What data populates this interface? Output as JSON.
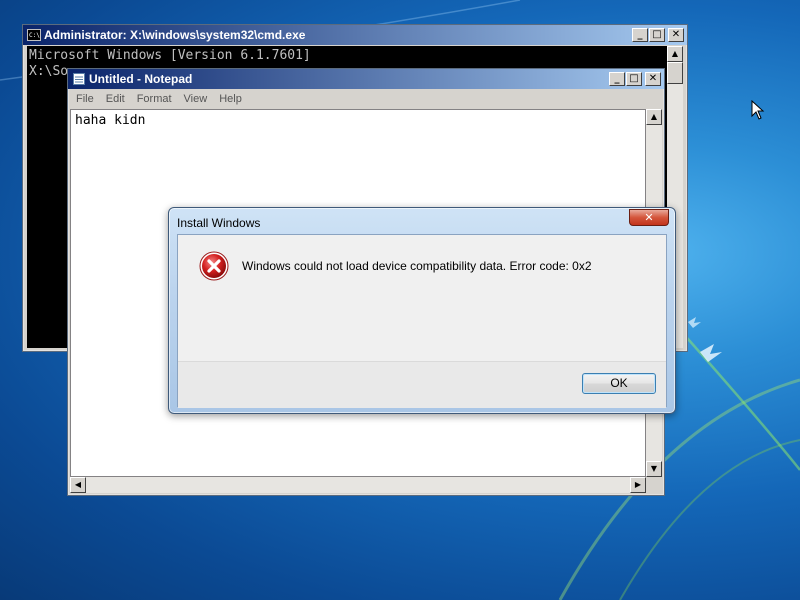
{
  "cmd_window": {
    "title": "Administrator: X:\\windows\\system32\\cmd.exe",
    "console_lines": [
      "Microsoft Windows [Version 6.1.7601]",
      "",
      "X:\\So"
    ]
  },
  "notepad_window": {
    "title": "Untitled - Notepad",
    "menu": [
      "File",
      "Edit",
      "Format",
      "View",
      "Help"
    ],
    "content": "haha kidn"
  },
  "dialog": {
    "title": "Install Windows",
    "message": "Windows could not load device compatibility data. Error code: 0x2",
    "ok_label": "OK",
    "close_glyph": "✕",
    "icon": "error-icon"
  },
  "caption_buttons": {
    "minimize": "_",
    "maximize": "□",
    "close": "✕"
  },
  "colors": {
    "titlebar_active": "#0a246a",
    "console_background": "#000000",
    "dialog_close": "#c2341c",
    "error_red": "#d32020",
    "desktop_blue": "#1467b8"
  }
}
